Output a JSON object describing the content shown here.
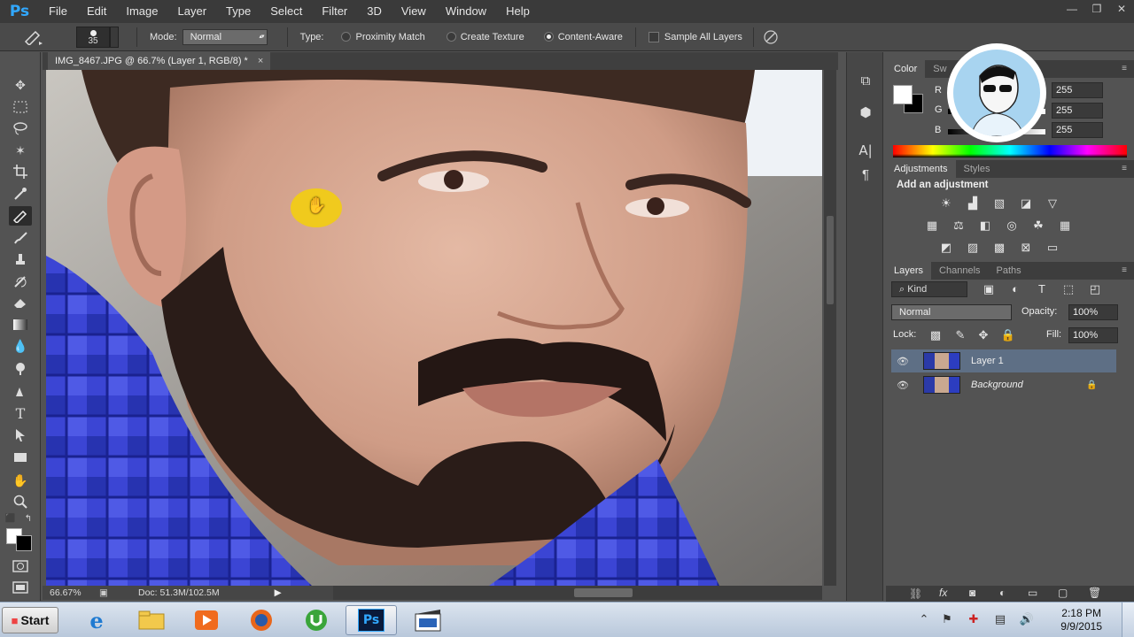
{
  "app": {
    "logo": "Ps"
  },
  "menu": [
    "File",
    "Edit",
    "Image",
    "Layer",
    "Type",
    "Select",
    "Filter",
    "3D",
    "View",
    "Window",
    "Help"
  ],
  "window_controls": [
    "minimize",
    "restore",
    "close"
  ],
  "options": {
    "brush_size": "35",
    "mode_label": "Mode:",
    "mode_value": "Normal",
    "type_label": "Type:",
    "type_options": [
      {
        "label": "Proximity Match",
        "selected": false
      },
      {
        "label": "Create Texture",
        "selected": false
      },
      {
        "label": "Content-Aware",
        "selected": true
      }
    ],
    "sample_all_layers": "Sample All Layers"
  },
  "document": {
    "tab_title": "IMG_8467.JPG @ 66.7% (Layer 1, RGB/8) *",
    "zoom": "66.67%",
    "doc_info": "Doc: 51.3M/102.5M"
  },
  "color_panel": {
    "tabs": [
      "Color",
      "Sw"
    ],
    "channels": [
      {
        "label": "R",
        "value": "255"
      },
      {
        "label": "G",
        "value": "255"
      },
      {
        "label": "B",
        "value": "255"
      }
    ]
  },
  "adjustments_panel": {
    "tabs": [
      "Adjustments",
      "Styles"
    ],
    "title": "Add an adjustment"
  },
  "layers_panel": {
    "tabs": [
      "Layers",
      "Channels",
      "Paths"
    ],
    "kind": "Kind",
    "blend_mode": "Normal",
    "opacity_label": "Opacity:",
    "opacity_value": "100%",
    "lock_label": "Lock:",
    "fill_label": "Fill:",
    "fill_value": "100%",
    "layers": [
      {
        "name": "Layer 1",
        "selected": true
      },
      {
        "name": "Background",
        "selected": false,
        "locked": true
      }
    ]
  },
  "taskbar": {
    "start": "Start",
    "apps": [
      "internet-explorer",
      "file-explorer",
      "media-player",
      "firefox",
      "utorrent",
      "photoshop",
      "video-editor"
    ],
    "time": "2:18 PM",
    "date": "9/9/2015"
  }
}
